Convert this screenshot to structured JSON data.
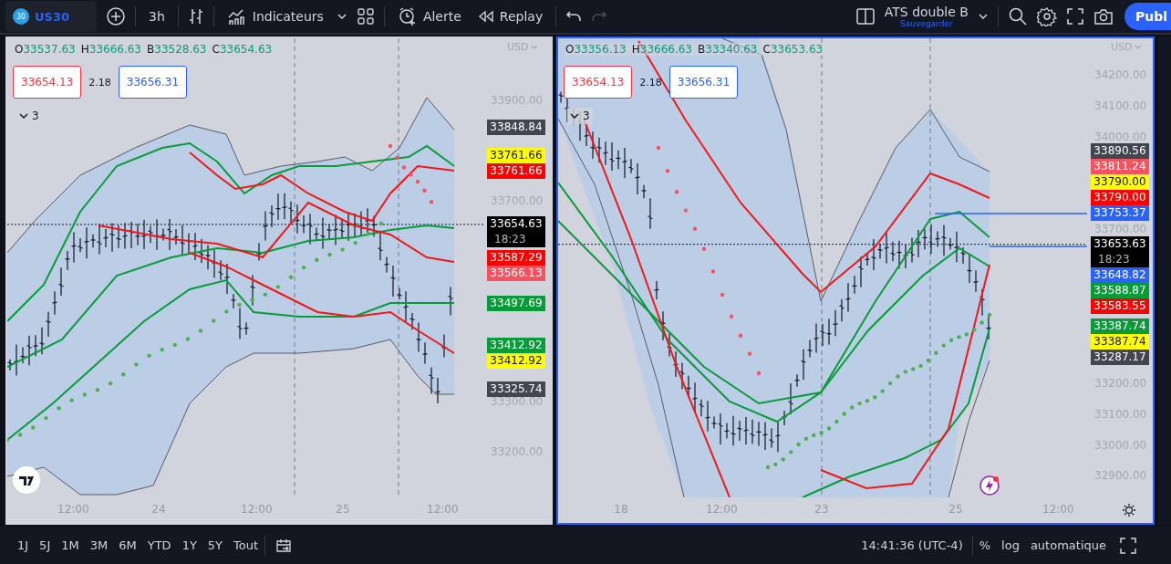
{
  "toolbar": {
    "symbol_badge": "30",
    "symbol": "US30",
    "interval": "3h",
    "indicators": "Indicateurs",
    "alert": "Alerte",
    "replay": "Replay",
    "redo_disabled": true,
    "layout_name": "ATS double B",
    "save": "Sauvegarder",
    "publish": "Publ"
  },
  "panes": [
    {
      "selected": false,
      "legend": [
        {
          "label": "O",
          "value": "33537.63"
        },
        {
          "label": "H",
          "value": "33666.63"
        },
        {
          "label": "B",
          "value": "33528.63"
        },
        {
          "label": "C",
          "value": "33654.63"
        }
      ],
      "bid": "33654.13",
      "spread": "2.18",
      "ask": "33656.31",
      "indicator_count": "3",
      "currency": "USD",
      "price_ticks": [
        "33900.00",
        "33700.00",
        "33300.00",
        "33200.00"
      ],
      "price_tags": [
        {
          "value": "33848.84",
          "color": "#434651"
        },
        {
          "value": "33761.66",
          "color": "#ffff00"
        },
        {
          "value": "33761.66",
          "color": "#ff0000"
        },
        {
          "value": "33654.63",
          "sub": "18:23",
          "color": "#000000"
        },
        {
          "value": "33587.29",
          "color": "#ff0000"
        },
        {
          "value": "33566.13",
          "color": "#f7525f"
        },
        {
          "value": "33497.69",
          "color": "#089b3a"
        },
        {
          "value": "33412.92",
          "color": "#089b3a"
        },
        {
          "value": "33412.92",
          "color": "#ffff00"
        },
        {
          "value": "33325.74",
          "color": "#434651"
        }
      ],
      "time_labels": [
        "12:00",
        "24",
        "12:00",
        "25",
        "12:00"
      ]
    },
    {
      "selected": true,
      "legend": [
        {
          "label": "O",
          "value": "33356.13"
        },
        {
          "label": "H",
          "value": "33666.63"
        },
        {
          "label": "B",
          "value": "33340.63"
        },
        {
          "label": "C",
          "value": "33653.63"
        }
      ],
      "bid": "33654.13",
      "spread": "2.18",
      "ask": "33656.31",
      "indicator_count": "3",
      "currency": "USD",
      "price_ticks": [
        "34200.00",
        "34100.00",
        "34000.00",
        "33700.00",
        "33200.00",
        "33100.00",
        "33000.00",
        "32900.00"
      ],
      "price_tags": [
        {
          "value": "33890.56",
          "color": "#434651"
        },
        {
          "value": "33811.24",
          "color": "#f7525f"
        },
        {
          "value": "33790.00",
          "color": "#ffff00"
        },
        {
          "value": "33790.00",
          "color": "#ff0000"
        },
        {
          "value": "33753.37",
          "color": "#2962ff"
        },
        {
          "value": "33653.63",
          "sub": "18:23",
          "color": "#000000"
        },
        {
          "value": "33648.82",
          "color": "#2962ff"
        },
        {
          "value": "33588.87",
          "color": "#089b3a"
        },
        {
          "value": "33583.55",
          "color": "#ff0000"
        },
        {
          "value": "33387.74",
          "color": "#089b3a"
        },
        {
          "value": "33387.74",
          "color": "#ffff00"
        },
        {
          "value": "33287.17",
          "color": "#434651"
        }
      ],
      "time_labels": [
        "18",
        "12:00",
        "23",
        "25",
        "12:00"
      ]
    }
  ],
  "bottom_bar": {
    "ranges": [
      "1J",
      "5J",
      "1M",
      "3M",
      "6M",
      "YTD",
      "1Y",
      "5Y",
      "Tout"
    ],
    "clock": "14:41:36 (UTC-4)",
    "percent": "%",
    "log": "log",
    "auto": "automatique"
  }
}
